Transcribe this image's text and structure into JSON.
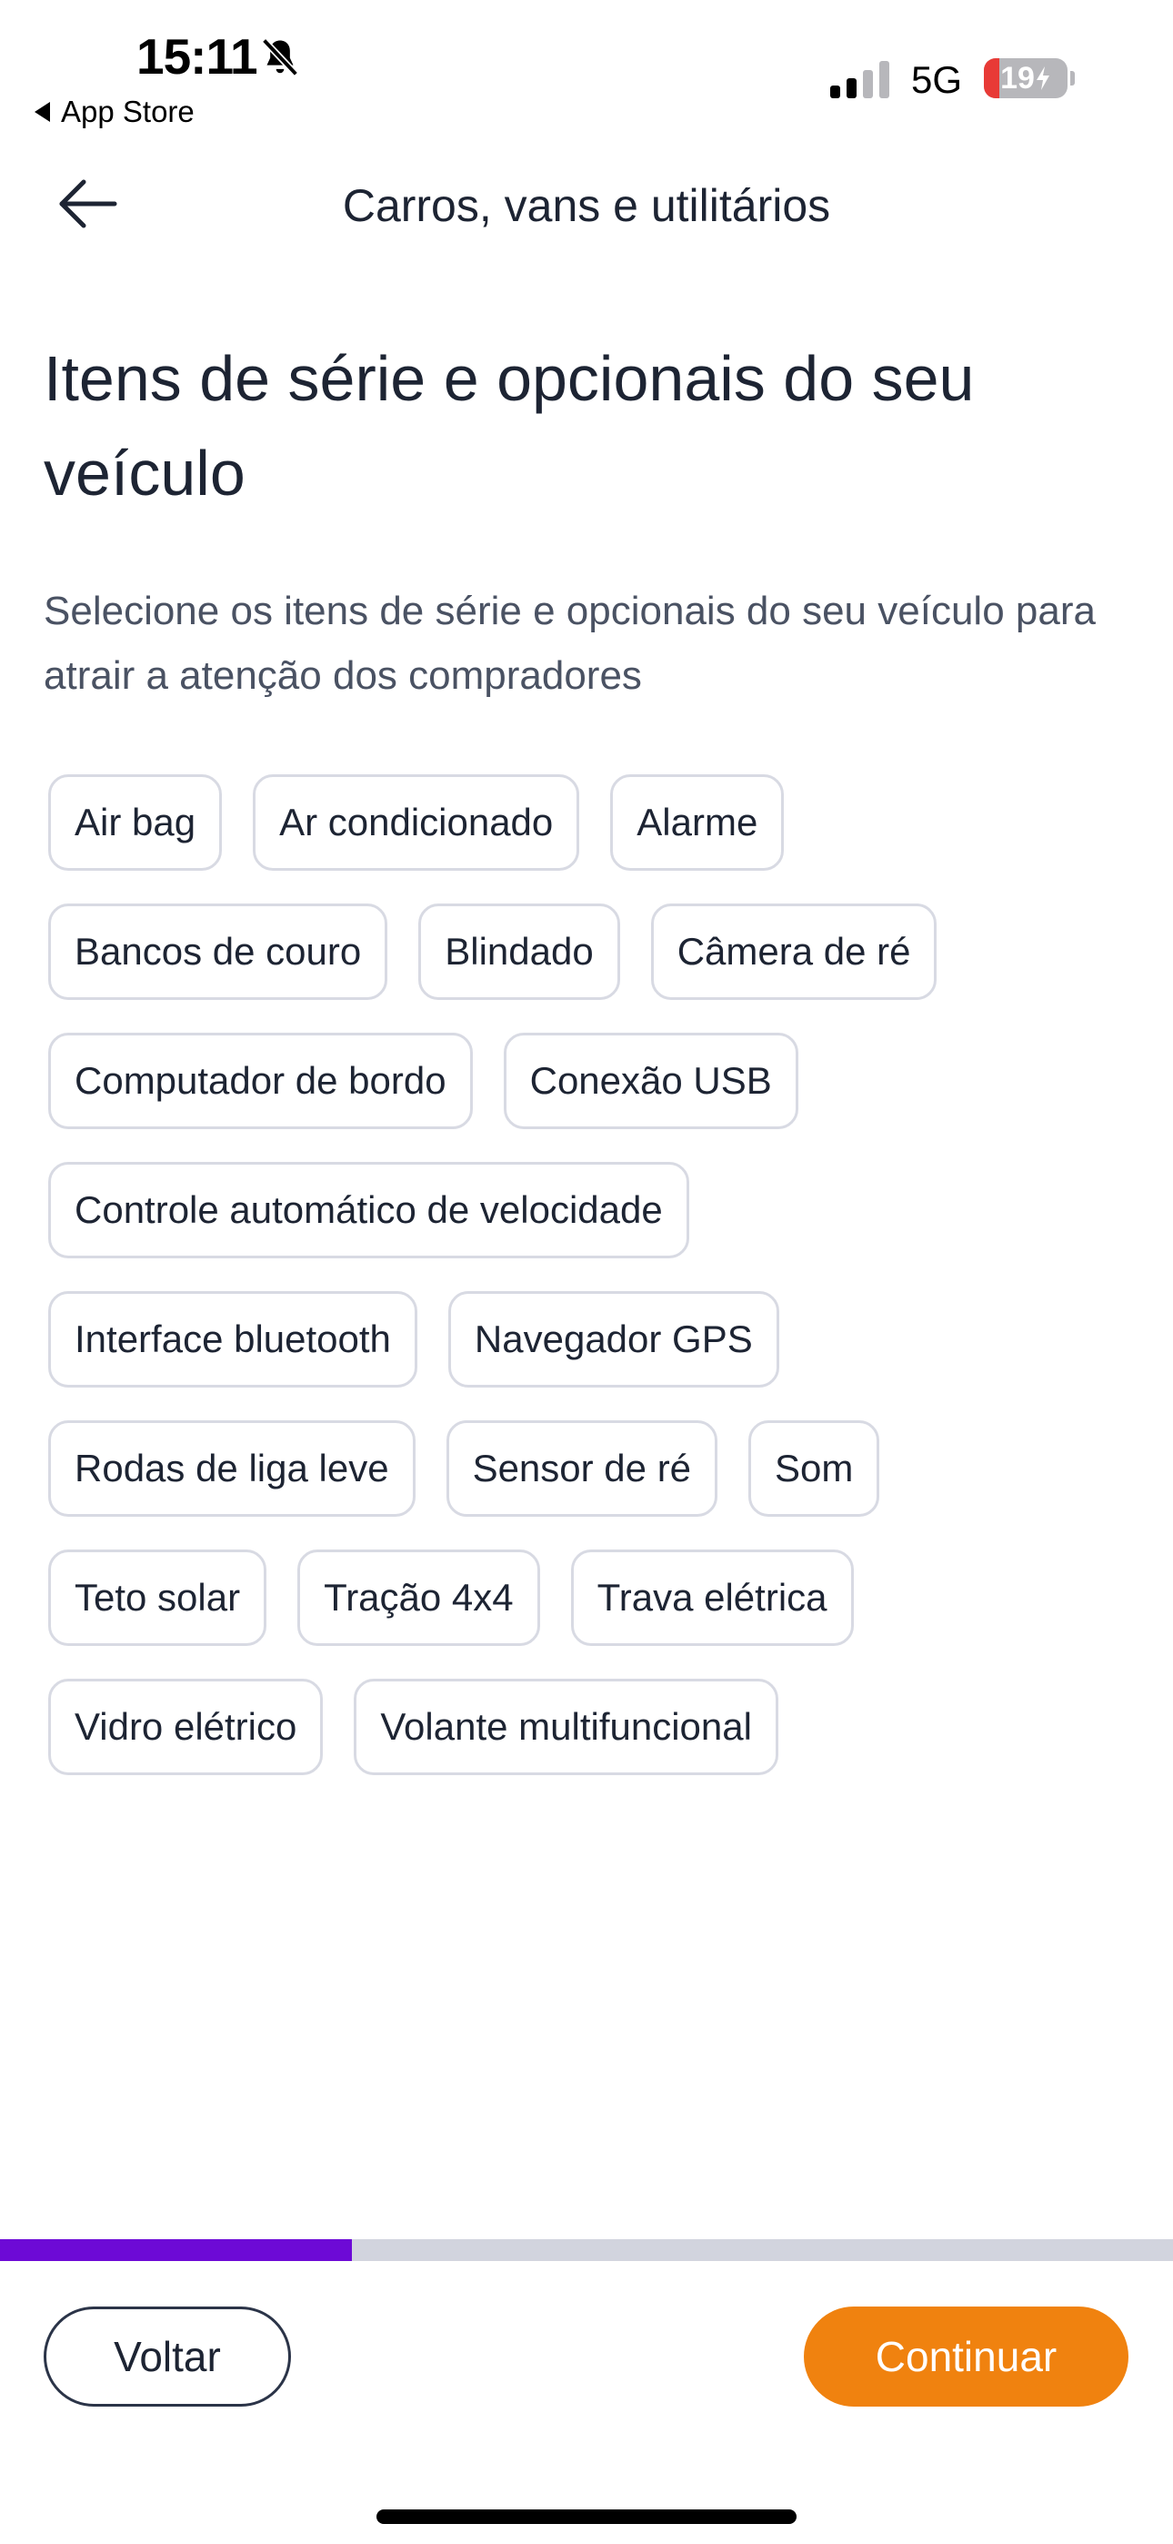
{
  "status_bar": {
    "time": "15:11",
    "back_app": "App Store",
    "network": "5G",
    "battery_percent": "19",
    "battery_level": 0.19,
    "bell_icon": "bell-slash-icon",
    "signal_icon": "cellular-signal-icon"
  },
  "header": {
    "title": "Carros, vans e utilitários",
    "back_icon": "arrow-left-icon"
  },
  "main": {
    "title": "Itens de série e opcionais do seu veículo",
    "subtitle": "Selecione os itens de série e opcionais do seu veículo para atrair a atenção dos compradores",
    "chip_rows": [
      [
        "Air bag",
        "Ar condicionado",
        "Alarme"
      ],
      [
        "Bancos de couro",
        "Blindado",
        "Câmera de ré"
      ],
      [
        "Computador de bordo",
        "Conexão USB"
      ],
      [
        "Controle automático de velocidade"
      ],
      [
        "Interface bluetooth",
        "Navegador GPS"
      ],
      [
        "Rodas de liga leve",
        "Sensor de ré",
        "Som"
      ],
      [
        "Teto solar",
        "Tração 4x4",
        "Trava elétrica"
      ],
      [
        "Vidro elétrico",
        "Volante multifuncional"
      ]
    ]
  },
  "progress": {
    "value": 0.3
  },
  "footer": {
    "back_label": "Voltar",
    "continue_label": "Continuar"
  },
  "colors": {
    "accent_purple": "#6d0ad6",
    "accent_orange": "#f0820f",
    "chip_border": "#d8dae3",
    "text": "#1d2433"
  }
}
